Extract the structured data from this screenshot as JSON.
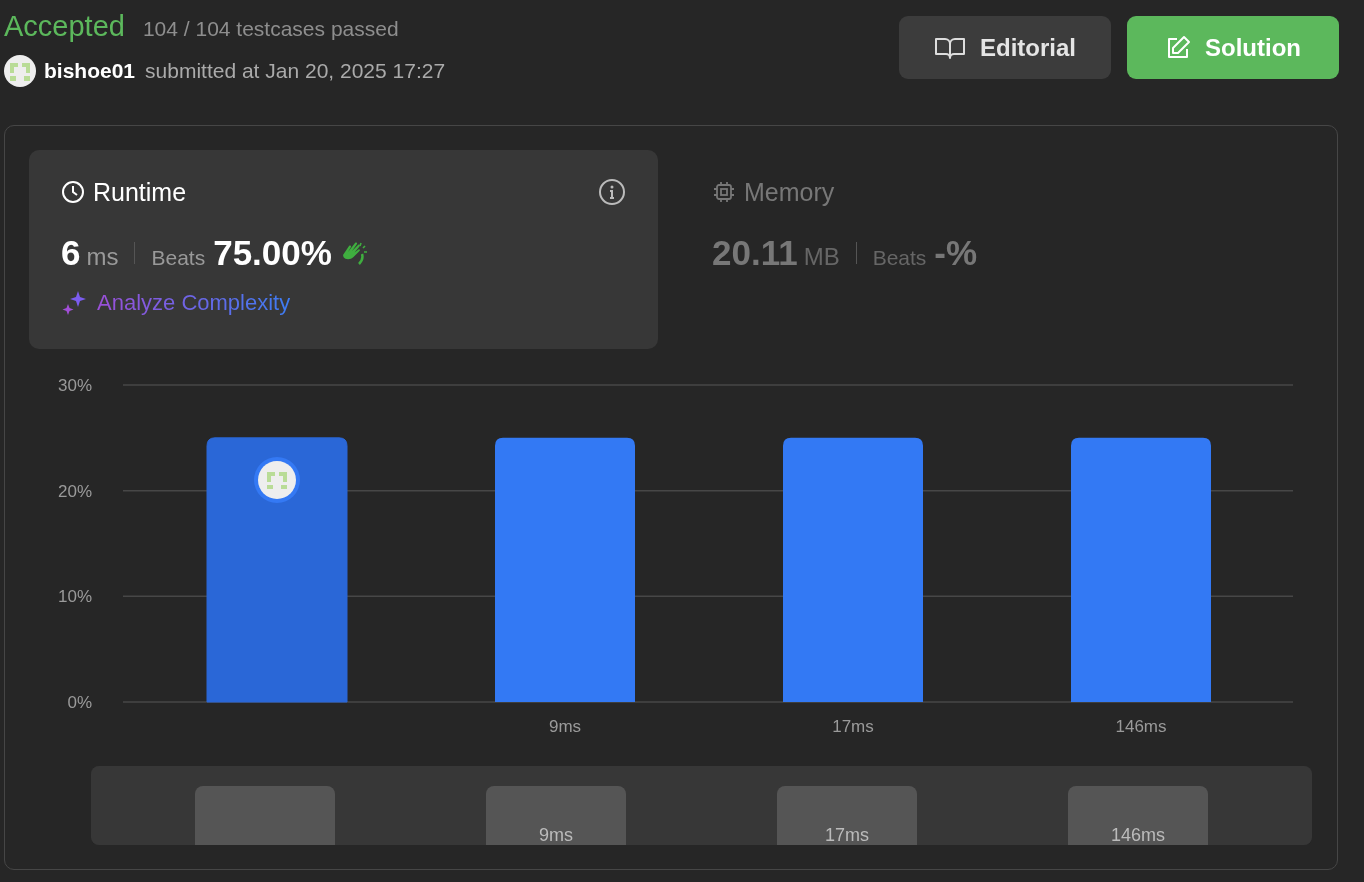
{
  "submission": {
    "status": "Accepted",
    "testcases": "104 / 104 testcases passed",
    "user": "bishoe01",
    "submitted": "submitted at Jan 20, 2025 17:27"
  },
  "buttons": [
    {
      "kind": "editorial",
      "label": "Editorial"
    },
    {
      "kind": "solution",
      "label": "Solution"
    }
  ],
  "runtime": {
    "title": "Runtime",
    "value": "6",
    "unit": "ms",
    "beats_label": "Beats",
    "beats": "75.00%",
    "action": "Analyze Complexity",
    "selected": true
  },
  "memory": {
    "title": "Memory",
    "value": "20.11",
    "unit": "MB",
    "beats_label": "Beats",
    "beats": "-%",
    "selected": false
  },
  "chart": {
    "bars": [
      {
        "selected": true,
        "color": "#2a67d7"
      },
      {
        "selected": false,
        "color": "#3379f4"
      },
      {
        "selected": false,
        "color": "#3379f4"
      },
      {
        "selected": false,
        "color": "#3379f4"
      }
    ],
    "chart_data": {
      "type": "bar",
      "categories": [
        null,
        "9ms",
        "17ms",
        "146ms"
      ],
      "values": [
        25,
        25,
        25,
        25
      ],
      "ylim": [
        0,
        30
      ],
      "yticks": [
        {
          "value": 0,
          "label": "0%"
        },
        {
          "value": 10,
          "label": "10%"
        },
        {
          "value": 20,
          "label": "20%"
        },
        {
          "value": 30,
          "label": "30%"
        }
      ]
    }
  },
  "range_slider": {
    "level": 1,
    "handles": [
      {
        "kind": "blank"
      },
      {
        "kind": "labeled",
        "label": "9ms"
      },
      {
        "kind": "labeled",
        "label": "17ms"
      },
      {
        "kind": "labeled",
        "label": "146ms"
      }
    ]
  }
}
